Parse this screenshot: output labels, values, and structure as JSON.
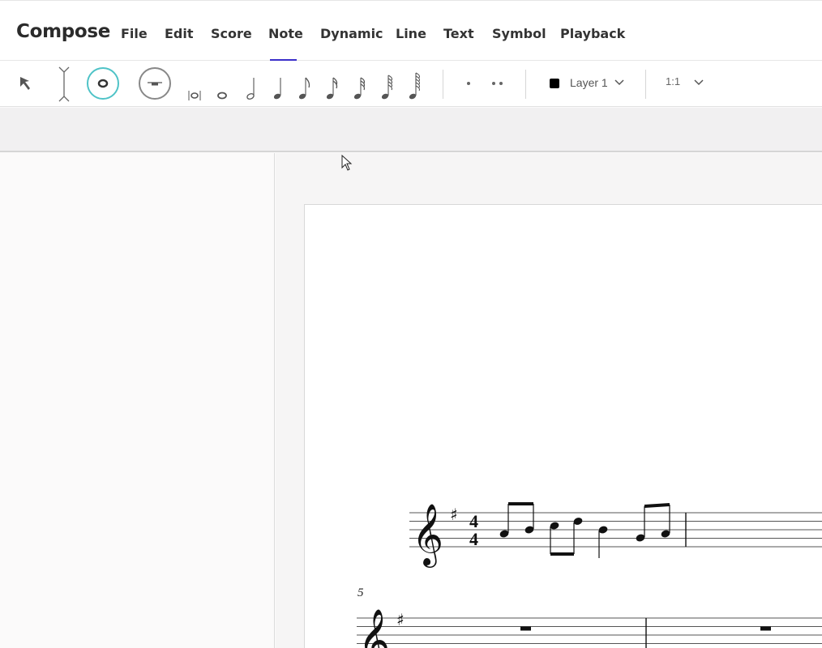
{
  "app": {
    "title": "Compose"
  },
  "menu": {
    "items": [
      "File",
      "Edit",
      "Score",
      "Note",
      "Dynamic",
      "Line",
      "Text",
      "Symbol",
      "Playback"
    ],
    "active": "Note"
  },
  "toolbar": {
    "tools": [
      {
        "name": "select-arrow-icon"
      },
      {
        "name": "insert-cursor-icon"
      },
      {
        "name": "note-input-icon",
        "active": true
      },
      {
        "name": "rest-input-icon"
      }
    ],
    "durations": [
      "breve",
      "whole",
      "half",
      "quarter",
      "eighth",
      "16th",
      "32nd",
      "64th",
      "128th"
    ],
    "dots": [
      "single-dot",
      "double-dot"
    ],
    "layer": {
      "label": "Layer 1",
      "color": "#000000"
    },
    "ratio": {
      "label": "1:1"
    },
    "accent_color": "#4fc3c7"
  },
  "score": {
    "key_signature": "G major (1 sharp)",
    "time_signature": {
      "top": "4",
      "bottom": "4"
    },
    "measure_number": "5"
  }
}
